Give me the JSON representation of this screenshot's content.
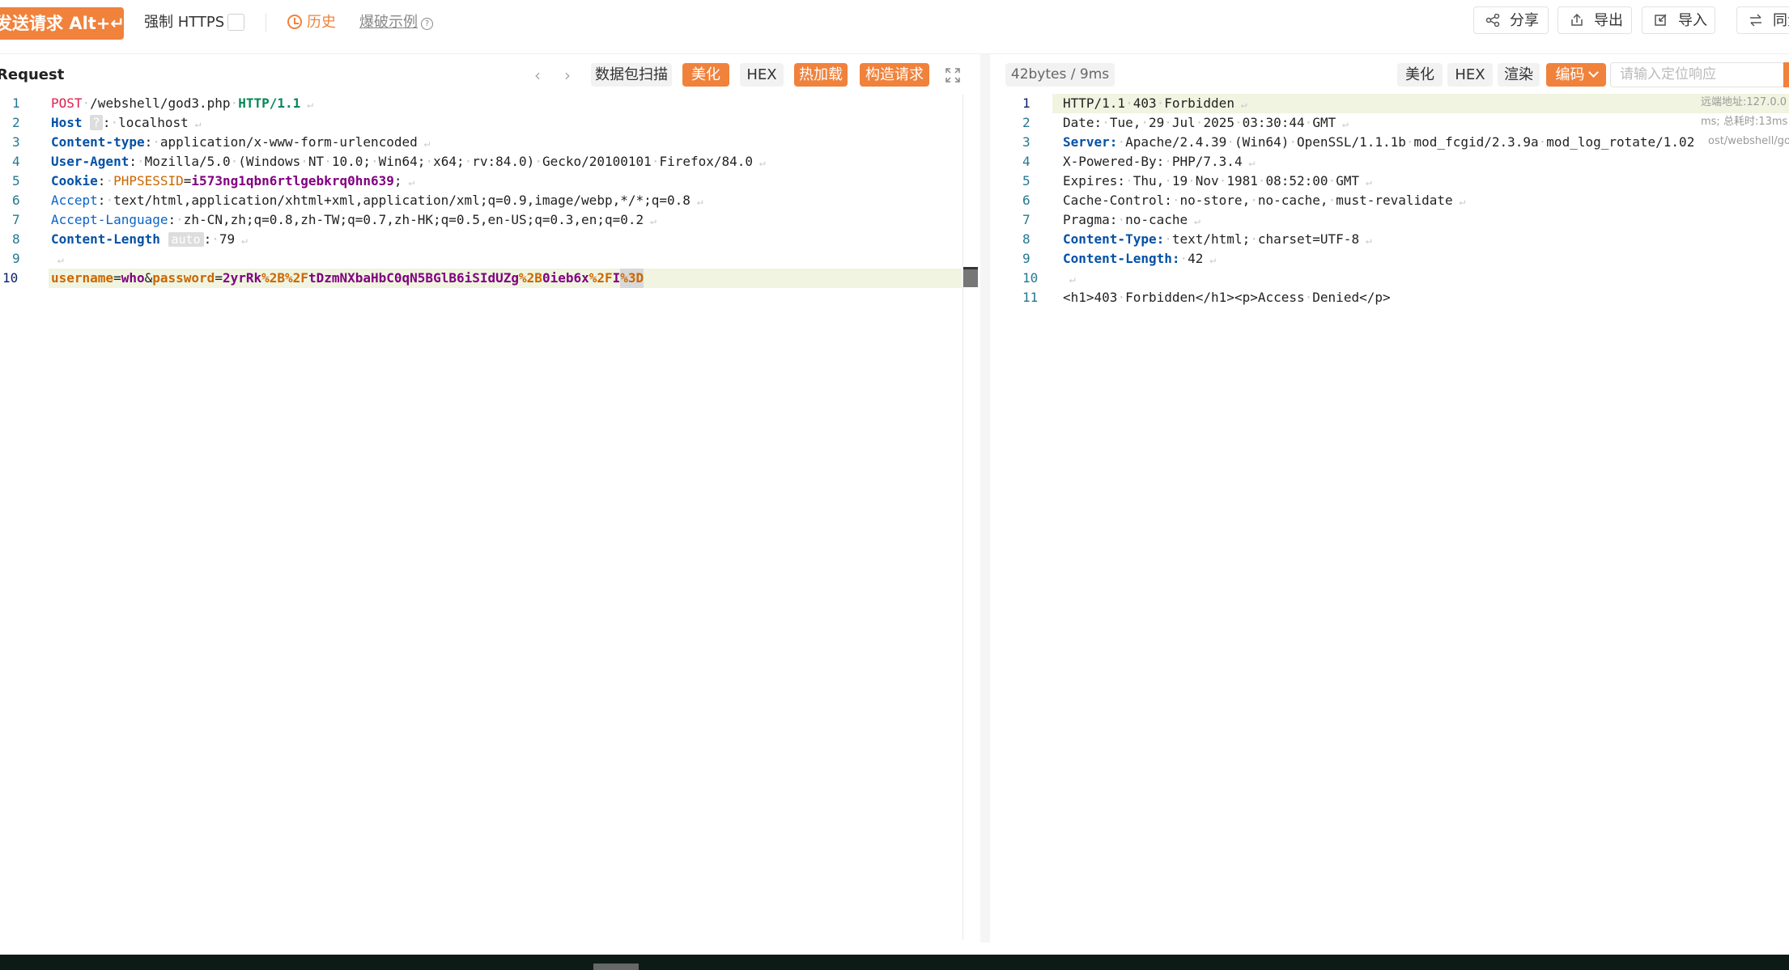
{
  "toolbar": {
    "send_label": "发送请求 Alt+↵",
    "force_https_label": "强制 HTTPS",
    "history_label": "历史",
    "brute_label": "爆破示例",
    "share_label": "分享",
    "export_label": "导出",
    "import_label": "导入",
    "sync_label": "同步"
  },
  "request": {
    "title": "Request",
    "buttons": {
      "packet_scan": "数据包扫描",
      "beautify": "美化",
      "hex": "HEX",
      "hot_load": "热加载",
      "construct": "构造请求"
    },
    "lines": [
      {
        "n": "1",
        "method": "POST",
        "path": "/webshell/god3.php",
        "proto": "HTTP/1.1"
      },
      {
        "n": "2",
        "key": "Host",
        "badge": "?",
        "value": "localhost"
      },
      {
        "n": "3",
        "key": "Content-type",
        "value": "application/x-www-form-urlencoded"
      },
      {
        "n": "4",
        "key": "User-Agent",
        "value": "Mozilla/5.0 (Windows NT 10.0; Win64; x64; rv:84.0) Gecko/20100101 Firefox/84.0"
      },
      {
        "n": "5",
        "key": "Cookie",
        "ckey": "PHPSESSID",
        "cval": "i573ng1qbn6rtlgebkrq0hn639"
      },
      {
        "n": "6",
        "key": "Accept",
        "value": "text/html,application/xhtml+xml,application/xml;q=0.9,image/webp,*/*;q=0.8"
      },
      {
        "n": "7",
        "key": "Accept-Language",
        "value": "zh-CN,zh;q=0.8,zh-TW;q=0.7,zh-HK;q=0.5,en-US;q=0.3,en;q=0.2"
      },
      {
        "n": "8",
        "key": "Content-Length",
        "badge": "auto",
        "value": "79"
      },
      {
        "n": "9"
      },
      {
        "n": "10",
        "body": {
          "k1": "username",
          "v1": "who",
          "k2": "password",
          "v2a": "2yrRk",
          "e1": "%2B",
          "e2": "%2F",
          "v2b": "tDzmNXbaHbC0qN5BGlB6iSIdUZg",
          "e3": "%2B",
          "v2c": "0ieb6x",
          "e4": "%2F",
          "v2d": "I",
          "e5": "%3D"
        }
      }
    ]
  },
  "response": {
    "stats": "42bytes / 9ms",
    "buttons": {
      "beautify": "美化",
      "hex": "HEX",
      "render": "渲染",
      "encoding": "编码"
    },
    "search_placeholder": "请输入定位响应",
    "side_notes": [
      "远端地址:127.0.0",
      "ms; 总耗时:13ms",
      "ost/webshell/go"
    ],
    "lines": [
      {
        "n": "1",
        "text": "HTTP/1.1 403 Forbidden"
      },
      {
        "n": "2",
        "text": "Date: Tue, 29 Jul 2025 03:30:44 GMT"
      },
      {
        "n": "3",
        "key": "Server:",
        "value": "Apache/2.4.39 (Win64) OpenSSL/1.1.1b mod_fcgid/2.3.9a mod_log_rotate/1.02"
      },
      {
        "n": "4",
        "text": "X-Powered-By: PHP/7.3.4"
      },
      {
        "n": "5",
        "text": "Expires: Thu, 19 Nov 1981 08:52:00 GMT"
      },
      {
        "n": "6",
        "text": "Cache-Control: no-store, no-cache, must-revalidate"
      },
      {
        "n": "7",
        "text": "Pragma: no-cache"
      },
      {
        "n": "8",
        "key": "Content-Type:",
        "value": "text/html; charset=UTF-8"
      },
      {
        "n": "9",
        "key": "Content-Length:",
        "value": "42"
      },
      {
        "n": "10",
        "text": ""
      },
      {
        "n": "11",
        "text": "<h1>403 Forbidden</h1><p>Access Denied</p>"
      }
    ]
  },
  "colors": {
    "accent": "#f0823c",
    "key_blue": "#0451a5",
    "method_red": "#e11d48",
    "proto_green": "#098658",
    "cookie_orange": "#cc6600",
    "body_purple": "#800080"
  }
}
